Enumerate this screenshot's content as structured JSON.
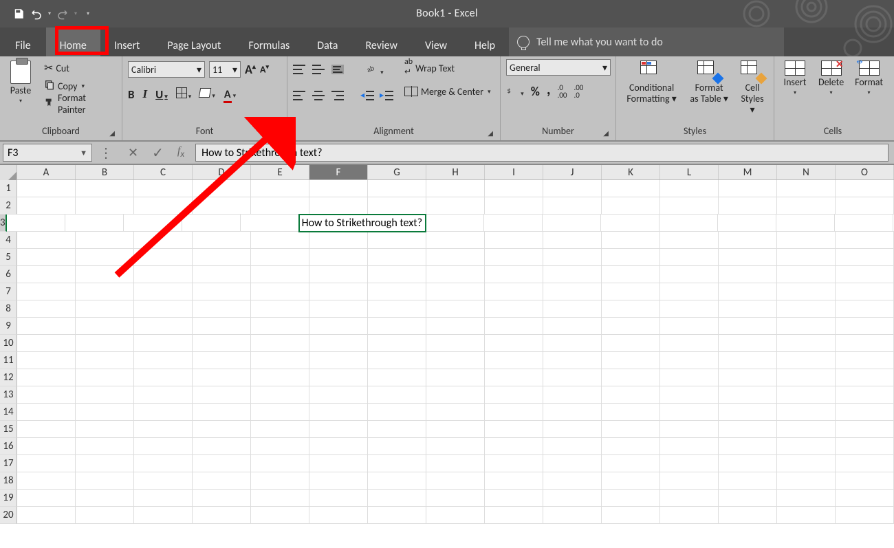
{
  "title": "Book1  -  Excel",
  "qat": {},
  "tabs": {
    "file": "File",
    "home": "Home",
    "insert": "Insert",
    "page_layout": "Page Layout",
    "formulas": "Formulas",
    "data": "Data",
    "review": "Review",
    "view": "View",
    "help": "Help",
    "tellme": "Tell me what you want to do"
  },
  "ribbon": {
    "clipboard": {
      "label": "Clipboard",
      "paste": "Paste",
      "cut": "Cut",
      "copy": "Copy",
      "format_painter": "Format Painter"
    },
    "font": {
      "label": "Font",
      "font_name": "Calibri",
      "font_size": "11",
      "bold": "B",
      "italic": "I",
      "underline": "U",
      "increase_a": "A",
      "decrease_a": "A",
      "font_color_letter": "A"
    },
    "alignment": {
      "label": "Alignment",
      "wrap": "Wrap Text",
      "merge": "Merge & Center"
    },
    "number": {
      "label": "Number",
      "format": "General",
      "percent": "%",
      "comma": ","
    },
    "styles": {
      "label": "Styles",
      "conditional": "Conditional Formatting",
      "format_table": "Format as Table",
      "cell_styles": "Cell Styles"
    },
    "cells": {
      "label": "Cells",
      "insert": "Insert",
      "delete": "Delete",
      "format": "Format"
    }
  },
  "fx": {
    "namebox": "F3",
    "formula": "How to Strikethrough text?"
  },
  "columns": [
    "A",
    "B",
    "C",
    "D",
    "E",
    "F",
    "G",
    "H",
    "I",
    "J",
    "K",
    "L",
    "M",
    "N",
    "O"
  ],
  "rows": [
    1,
    2,
    3,
    4,
    5,
    6,
    7,
    8,
    9,
    10,
    11,
    12,
    13,
    14,
    15,
    16,
    17,
    18,
    19,
    20
  ],
  "active_cell": {
    "col": "F",
    "row": 3,
    "value": "How to Strikethrough text?"
  }
}
